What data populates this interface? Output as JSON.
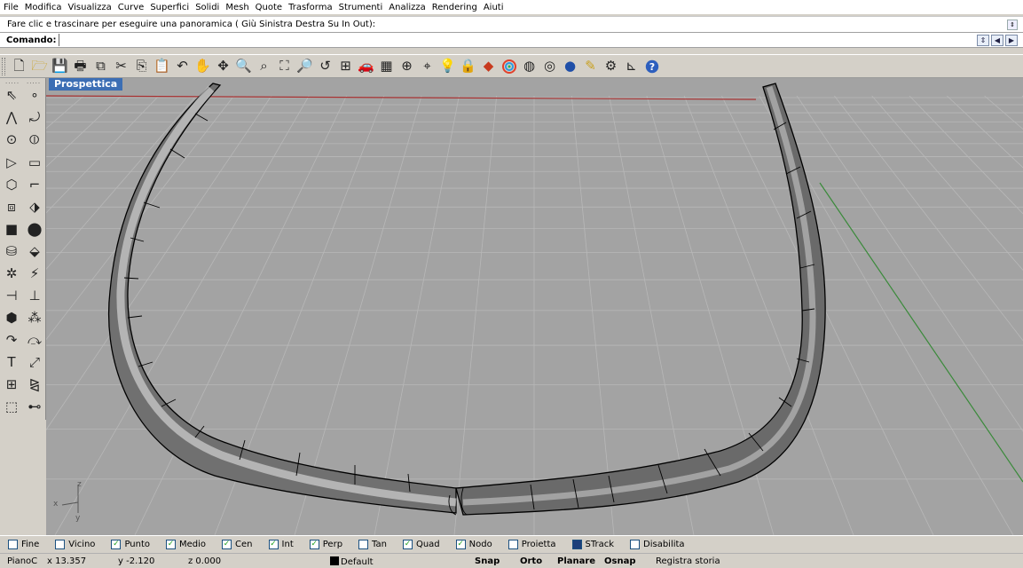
{
  "menu": [
    "File",
    "Modifica",
    "Visualizza",
    "Curve",
    "Superfici",
    "Solidi",
    "Mesh",
    "Quote",
    "Trasforma",
    "Strumenti",
    "Analizza",
    "Rendering",
    "Aiuti"
  ],
  "command": {
    "history_text": "Fare clic e trascinare per eseguire una panoramica ( Giù  Sinistra  Destra  Su  In  Out):",
    "prompt_label": "Comando:",
    "input_value": ""
  },
  "toolbar_icons": [
    "new-file-icon",
    "open-folder-icon",
    "save-icon",
    "print-icon",
    "export-icon",
    "cut-icon",
    "copy-icon",
    "paste-icon",
    "undo-icon",
    "pan-hand-icon",
    "rotate-view-icon",
    "zoom-dynamic-icon",
    "zoom-window-icon",
    "zoom-extents-icon",
    "zoom-selected-icon",
    "undo-view-icon",
    "four-viewports-icon",
    "car-icon",
    "grid-icon",
    "cplane-icon",
    "target-icon",
    "light-bulb-icon",
    "lock-icon",
    "layer-icon",
    "color-wheel-icon",
    "wireframe-sphere-icon",
    "shaded-sphere-icon",
    "rendered-sphere-icon",
    "pen-icon",
    "gear-icon",
    "dimension-icon",
    "help-icon"
  ],
  "viewport": {
    "title": "Prospettica"
  },
  "axis_labels": {
    "x": "x",
    "y": "y",
    "z": "z"
  },
  "osnap": [
    {
      "label": "Fine",
      "checked": false
    },
    {
      "label": "Vicino",
      "checked": false
    },
    {
      "label": "Punto",
      "checked": true
    },
    {
      "label": "Medio",
      "checked": true
    },
    {
      "label": "Cen",
      "checked": true
    },
    {
      "label": "Int",
      "checked": true
    },
    {
      "label": "Perp",
      "checked": true
    },
    {
      "label": "Tan",
      "checked": false
    },
    {
      "label": "Quad",
      "checked": true
    },
    {
      "label": "Nodo",
      "checked": true
    },
    {
      "label": "Proietta",
      "checked": false
    },
    {
      "label": "STrack",
      "checked": true
    },
    {
      "label": "Disabilita",
      "checked": false
    }
  ],
  "status": {
    "cplane": "PianoC",
    "x": "x 13.357",
    "y": "y -2.120",
    "z": "z 0.000",
    "layer": "Default",
    "snap": "Snap",
    "ortho": "Orto",
    "planar": "Planare",
    "osnap": "Osnap",
    "history": "Registra storia"
  }
}
